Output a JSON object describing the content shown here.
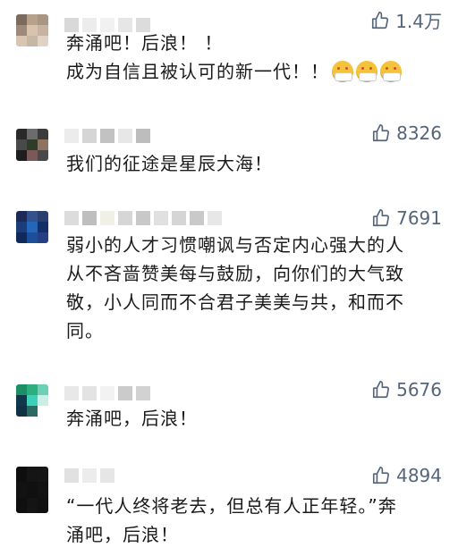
{
  "comments": [
    {
      "likes": "1.4万",
      "lines": [
        "奔涌吧！后浪！ ！",
        "成为自信且被认可的新一代！！"
      ],
      "emoji_count": 3,
      "avatar_colors": [
        "#7b6a5e",
        "#b9a08a",
        "#a89584",
        "#9d8a7a",
        "#d7c3ae",
        "#c8b3a0",
        "#d8c6b3",
        "#c7b7a5",
        "#e0d2c4"
      ],
      "name_blocks": [
        "#d9d9d9",
        "#ececec",
        "#f1f1f1",
        "#e6e6e6",
        "#dcdcdc"
      ]
    },
    {
      "likes": "8326",
      "lines": [
        "我们的征途是星辰大海！"
      ],
      "avatar_colors": [
        "#2a2a2a",
        "#6c6c6c",
        "#3b3b3b",
        "#4a4a4a",
        "#2e3d2a",
        "#8d7360",
        "#1e1e1e",
        "#7d5858",
        "#494949"
      ],
      "name_blocks": [
        "#ececec",
        "#d5d5d5",
        "#c2c2c2",
        "#e7e7e7",
        "#bdbdbd"
      ]
    },
    {
      "likes": "7691",
      "lines": [
        "弱小的人才习惯嘲讽与否定内心强大的人",
        "从不吝啬赞美每与鼓励，向你们的大气致",
        "敬，小人同而不合君子美美与共，和而不",
        "同。"
      ],
      "avatar_colors": [
        "#1c2a55",
        "#35518c",
        "#2a3f6e",
        "#1b3e7a",
        "#2466b8",
        "#10306a",
        "#0f2a5a",
        "#1c4f9a",
        "#263f82"
      ],
      "name_blocks": [
        "#dcdcdc",
        "#bebebe",
        "#f0f0e6",
        "#d6d6d6",
        "#c8c8c8",
        "#e0e0e0",
        "#d5d5d5",
        "#c9c9c9",
        "#e7e7e7"
      ]
    },
    {
      "likes": "5676",
      "lines": [
        "奔涌吧，后浪！"
      ],
      "avatar_colors": [
        "#1d8f66",
        "#2eae7f",
        "#6bd0b6",
        "#11384a",
        "#3cd0b9",
        "#c8f0e6",
        "#0e3244",
        "#2a6a63",
        "#ffffff"
      ],
      "name_blocks": [
        "#e8e8e8",
        "#e3e3e3",
        "#f2f2f2",
        "#cbcbcb",
        "#d2d2d2"
      ]
    },
    {
      "likes": "4894",
      "lines": [
        "“一代人终将老去，但总有人正年轻。”奔",
        "涌吧，后浪！"
      ],
      "avatar_colors": [
        "#0e0e0e",
        "#151515",
        "#161616",
        "#121212",
        "#101010",
        "#131313",
        "#0f0f0f",
        "#141414",
        "#111111"
      ],
      "name_blocks": [
        "#e1e1e1",
        "#ececec",
        "#e6e6e6"
      ]
    }
  ]
}
